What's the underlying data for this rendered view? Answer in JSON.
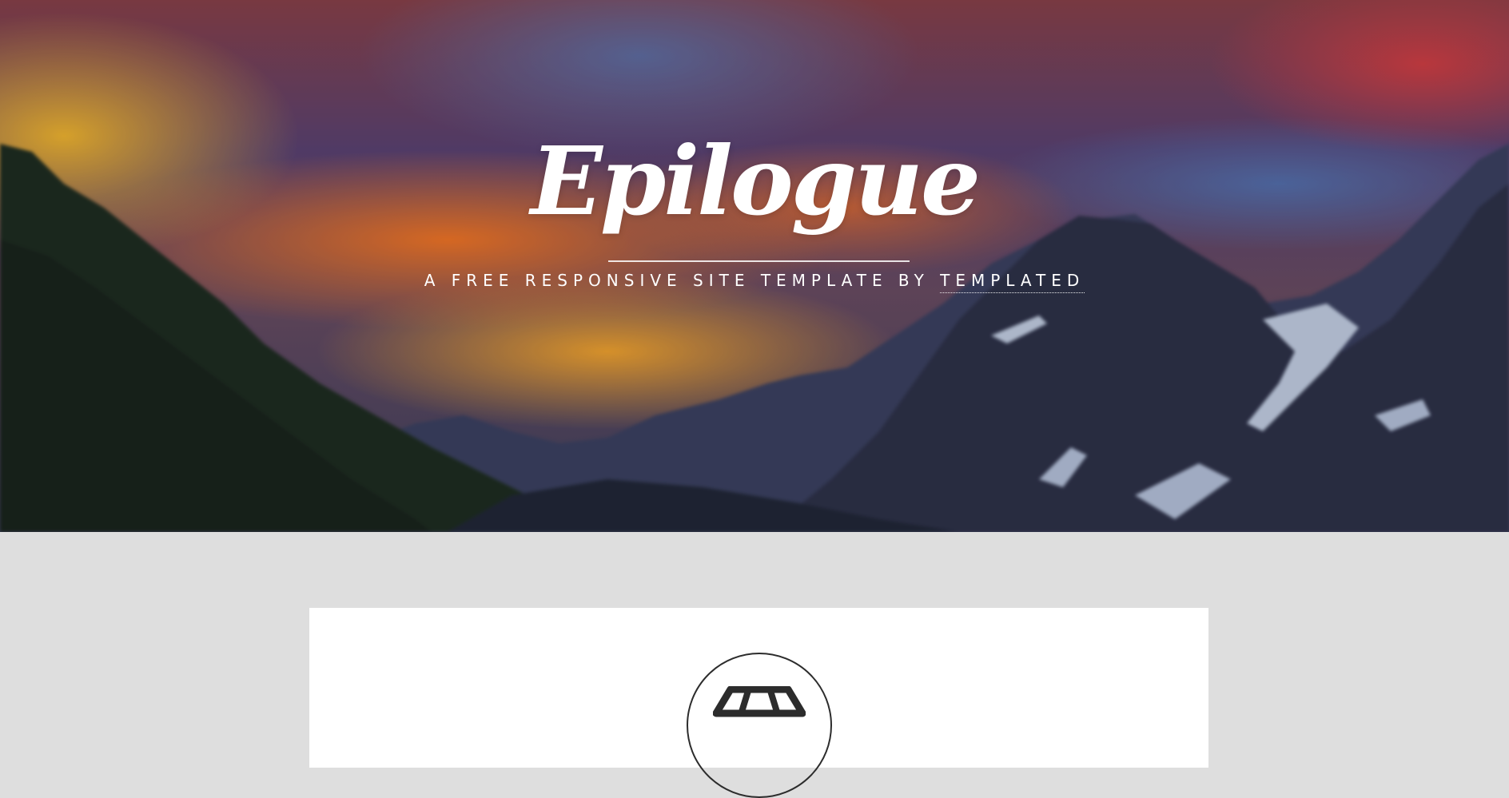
{
  "banner": {
    "title": "Epilogue",
    "tagline_prefix": "A FREE RESPONSIVE SITE TEMPLATE BY ",
    "tagline_link": "TEMPLATED"
  },
  "main": {
    "feature_icon": "road-icon"
  }
}
